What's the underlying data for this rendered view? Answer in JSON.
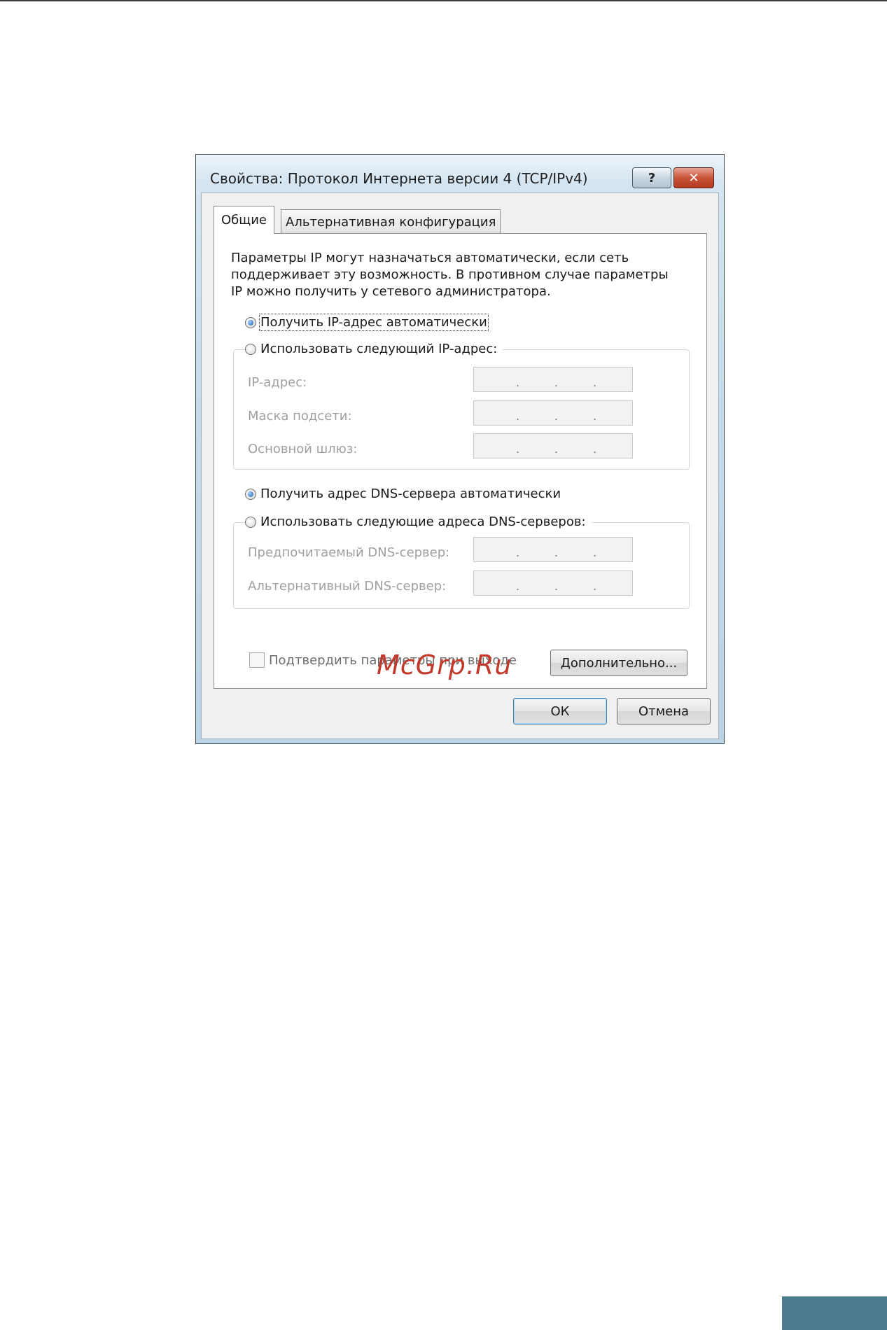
{
  "dialog": {
    "title": "Свойства: Протокол Интернета версии 4 (TCP/IPv4)",
    "help_glyph": "?",
    "close_glyph": "✕"
  },
  "tabs": [
    {
      "label": "Общие",
      "active": true
    },
    {
      "label": "Альтернативная конфигурация",
      "active": false
    }
  ],
  "description": [
    "Параметры IP могут назначаться автоматически, если сеть",
    "поддерживает эту возможность. В противном случае параметры",
    "IP можно получить у сетевого администратора."
  ],
  "ip": {
    "auto_label": "Получить IP-адрес автоматически",
    "auto_selected": true,
    "manual_label": "Использовать следующий IP-адрес:",
    "fields": [
      {
        "label": "IP-адрес:",
        "value": ". . ."
      },
      {
        "label": "Маска подсети:",
        "value": ". . ."
      },
      {
        "label": "Основной шлюз:",
        "value": ". . ."
      }
    ]
  },
  "dns": {
    "auto_label": "Получить адрес DNS-сервера автоматически",
    "auto_selected": true,
    "manual_label": "Использовать следующие адреса DNS-серверов:",
    "fields": [
      {
        "label": "Предпочитаемый DNS-сервер:",
        "value": ". . ."
      },
      {
        "label": "Альтернативный DNS-сервер:",
        "value": ". . ."
      }
    ]
  },
  "validate_label": "Подтвердить параметры при выходе",
  "validate_checked": false,
  "buttons": {
    "advanced": "Дополнительно...",
    "ok": "ОК",
    "cancel": "Отмена"
  },
  "watermark": "McGrp.Ru",
  "colors": {
    "page_tab": "#4a7a8c",
    "watermark": "#c0392b",
    "close_button": "#c9553b"
  }
}
